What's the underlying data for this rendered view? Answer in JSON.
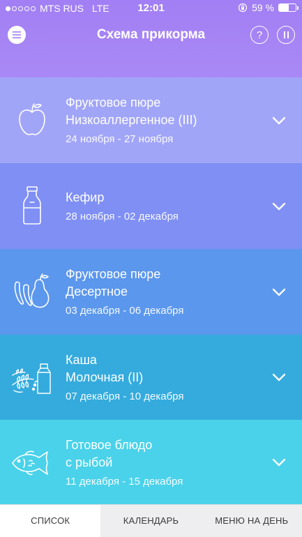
{
  "status": {
    "carrier": "MTS RUS",
    "network": "LTE",
    "time": "12:01",
    "battery": "59 %",
    "battery_level": 0.59,
    "signal_bars": 1
  },
  "nav": {
    "title": "Схема прикорма",
    "help_label": "?"
  },
  "items": [
    {
      "line1": "Фруктовое пюре",
      "line2": "Низкоаллергенное (III)",
      "dates": "24 ноября - 27 ноября",
      "icon": "apple-icon",
      "color": "#a1a5f8"
    },
    {
      "line1": "Кефир",
      "line2": "",
      "dates": "28 ноября - 02 декабря",
      "icon": "milk-bottle-icon",
      "color": "#7f8ff4"
    },
    {
      "line1": "Фруктовое пюре",
      "line2": "Десертное",
      "dates": "03 декабря - 06 декабря",
      "icon": "banana-pear-icon",
      "color": "#5b97ec"
    },
    {
      "line1": "Каша",
      "line2": "Молочная (II)",
      "dates": "07 декабря - 10 декабря",
      "icon": "wheat-milk-icon",
      "color": "#35abdd"
    },
    {
      "line1": "Готовое блюдо",
      "line2": "с рыбой",
      "dates": "11 декабря - 15 декабря",
      "icon": "fish-icon",
      "color": "#4ad2ea"
    }
  ],
  "tabs": [
    {
      "label": "СПИСОК",
      "active": true
    },
    {
      "label": "КАЛЕНДАРЬ",
      "active": false
    },
    {
      "label": "МЕНЮ НА ДЕНЬ",
      "active": false
    }
  ]
}
